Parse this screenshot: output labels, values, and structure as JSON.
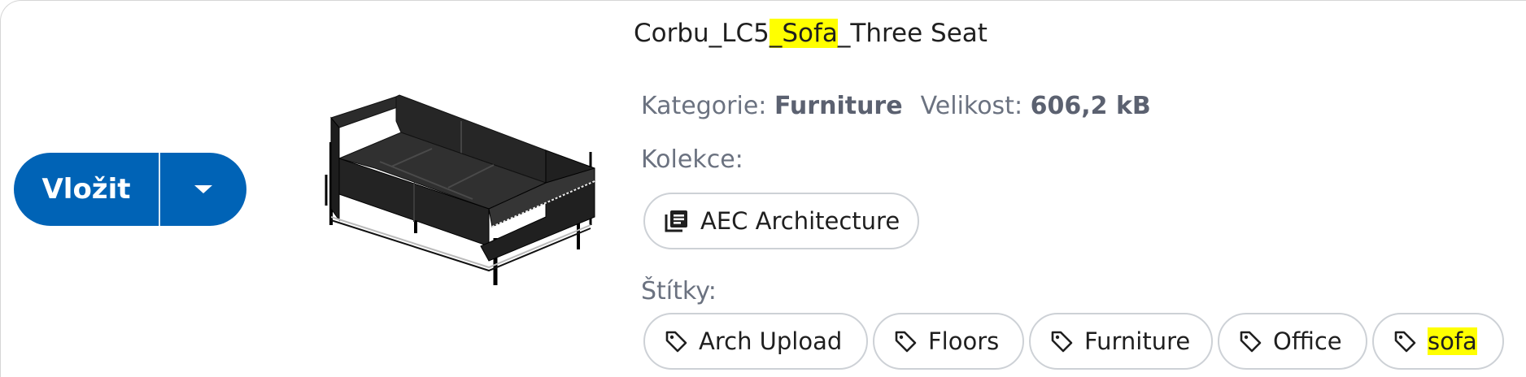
{
  "insert_button": {
    "label": "Vložit"
  },
  "asset": {
    "title_parts": [
      "Corbu_LC5",
      "_Sofa",
      "_Three Seat"
    ],
    "category_label": "Kategorie:",
    "category_value": "Furniture",
    "size_label": "Velikost:",
    "size_value": "606,2 kB",
    "collections_label": "Kolekce:",
    "collections": [
      {
        "label": "AEC Architecture",
        "icon": "library-icon"
      }
    ],
    "tags_label": "Štítky:",
    "tags": [
      {
        "label": "Arch Upload",
        "icon": "tag-icon"
      },
      {
        "label": "Floors",
        "icon": "tag-icon"
      },
      {
        "label": "Furniture",
        "icon": "tag-icon"
      },
      {
        "label": "Office",
        "icon": "tag-icon"
      },
      {
        "label": "sofa",
        "icon": "tag-icon"
      }
    ]
  },
  "colors": {
    "accent": "#0063b6",
    "highlight": "#ffff00",
    "muted_text": "#6b7280",
    "chip_border": "#cdd1d6"
  }
}
